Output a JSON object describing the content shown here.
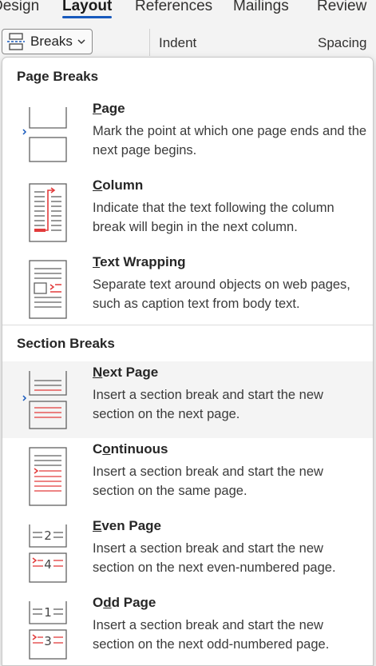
{
  "tabs": [
    "Design",
    "Layout",
    "References",
    "Mailings",
    "Review"
  ],
  "ribbon": {
    "breaks_label": "Breaks",
    "indent_label": "Indent",
    "spacing_label": "Spacing"
  },
  "menu": {
    "page_breaks_header": "Page Breaks",
    "section_breaks_header": "Section Breaks",
    "page": {
      "key": "P",
      "rest": "age",
      "desc": "Mark the point at which one page ends and the next page begins.",
      "icon": "page-break-icon"
    },
    "column": {
      "key": "C",
      "rest": "olumn",
      "desc": "Indicate that the text following the column break will begin in the next column.",
      "icon": "column-break-icon"
    },
    "text_wrapping": {
      "key": "T",
      "rest": "ext Wrapping",
      "desc": "Separate text around objects on web pages, such as caption text from body text.",
      "icon": "text-wrapping-icon"
    },
    "next_page": {
      "key": "N",
      "rest": "ext Page",
      "desc": "Insert a section break and start the new section on the next page.",
      "icon": "next-page-break-icon"
    },
    "continuous": {
      "pre": "C",
      "key": "o",
      "rest": "ntinuous",
      "desc": "Insert a section break and start the new section on the same page.",
      "icon": "continuous-break-icon"
    },
    "even_page": {
      "key": "E",
      "rest": "ven Page",
      "desc": "Insert a section break and start the new section on the next even-numbered page.",
      "icon": "even-page-break-icon",
      "num_top": "2",
      "num_bottom": "4"
    },
    "odd_page": {
      "pre": "O",
      "key": "d",
      "rest": "d Page",
      "desc": "Insert a section break and start the new section on the next odd-numbered page.",
      "icon": "odd-page-break-icon",
      "num_top": "1",
      "num_bottom": "3"
    }
  },
  "colors": {
    "accent": "#185abd",
    "icon_red": "#e23b3b",
    "icon_gray": "#616161",
    "hover_bg": "#f4f4f4"
  }
}
